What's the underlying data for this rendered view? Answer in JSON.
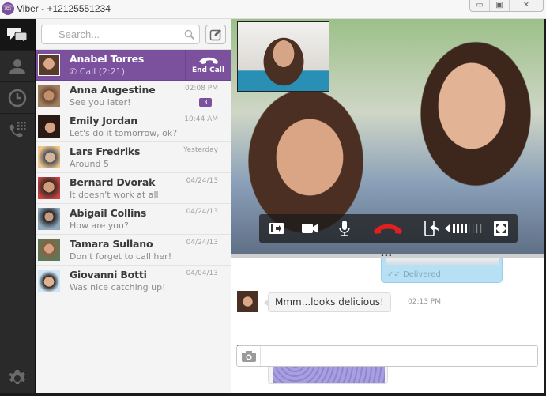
{
  "window": {
    "title": "Viber - +12125551234",
    "controls": {
      "minimize": "minimize",
      "maximize": "maximize",
      "close": "close"
    }
  },
  "nav": {
    "items": [
      {
        "id": "chats",
        "icon": "chat-bubbles-icon",
        "active": true
      },
      {
        "id": "contacts",
        "icon": "person-icon",
        "active": false
      },
      {
        "id": "recents",
        "icon": "clock-icon",
        "active": false
      },
      {
        "id": "keypad",
        "icon": "phone-keypad-icon",
        "active": false
      }
    ],
    "settings_icon": "gear-icon"
  },
  "search": {
    "placeholder": "Search...",
    "value": ""
  },
  "conversations": [
    {
      "name": "Anabel Torres",
      "message": "Call (2:21)",
      "time": "",
      "active": true,
      "action": "End Call"
    },
    {
      "name": "Anna Augestine",
      "message": "See you later!",
      "time": "02:08 PM",
      "badge": "3"
    },
    {
      "name": "Emily Jordan",
      "message": "Let's do it tomorrow, ok?",
      "time": "10:44 AM"
    },
    {
      "name": "Lars Fredriks",
      "message": "Around 5",
      "time": "Yesterday"
    },
    {
      "name": "Bernard Dvorak",
      "message": "It doesn't work at all",
      "time": "04/24/13"
    },
    {
      "name": "Abigail Collins",
      "message": "How are you?",
      "time": "04/24/13"
    },
    {
      "name": "Tamara Sullano",
      "message": "Don't forget to call her!",
      "time": "04/24/13"
    },
    {
      "name": "Giovanni Botti",
      "message": "Was nice catching up!",
      "time": "04/04/13"
    }
  ],
  "call_controls": {
    "buttons": [
      "transfer-call-icon",
      "video-camera-icon",
      "microphone-icon",
      "hang-up-icon",
      "transfer-to-mobile-icon",
      "volume-icon",
      "fullscreen-icon"
    ],
    "volume_level": 0.5,
    "colors": {
      "hangup": "#e02020"
    }
  },
  "chat": {
    "outgoing_status": "Delivered",
    "messages": [
      {
        "from": "Anabel Torres",
        "text": "Mmm...looks delicious!",
        "time": "02:13 PM"
      },
      {
        "from": "Anabel Torres",
        "type": "image"
      }
    ],
    "composer": {
      "placeholder": "",
      "value": ""
    }
  },
  "colors": {
    "accent": "#7b519d",
    "nav_bg": "#2a2a2a",
    "delivered_bubble": "#b7e0f4"
  }
}
